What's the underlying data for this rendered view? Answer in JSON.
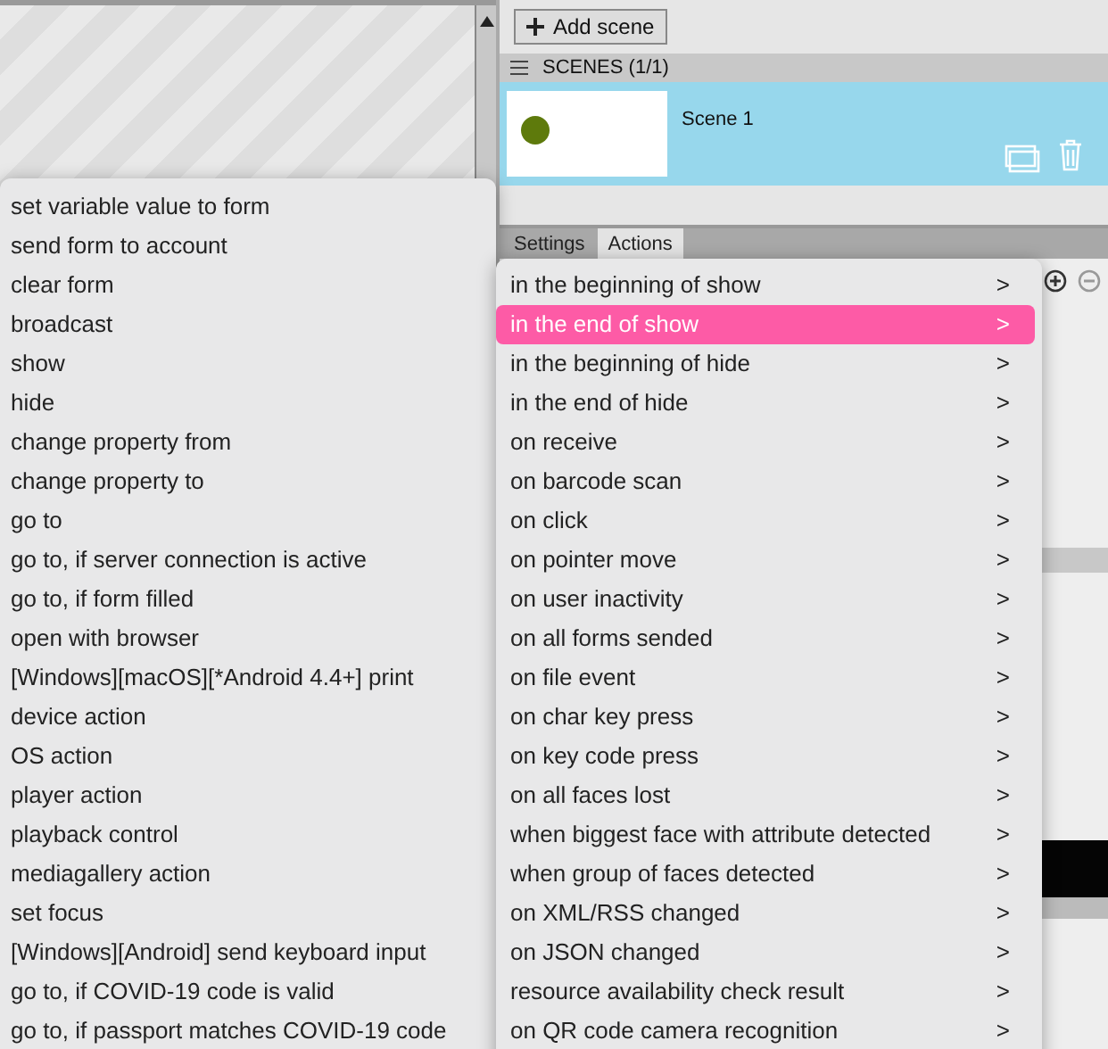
{
  "toolbar": {
    "add_button": "Add scene"
  },
  "scenes": {
    "header": "SCENES (1/1)",
    "items": [
      {
        "name": "Scene 1",
        "selected": true
      }
    ]
  },
  "tabs": [
    {
      "label": "Settings",
      "selected": false
    },
    {
      "label": "Actions",
      "selected": true
    }
  ],
  "action_menu": {
    "items": [
      {
        "label": "set variable value to form"
      },
      {
        "label": "send form to account"
      },
      {
        "label": "clear form"
      },
      {
        "label": "broadcast"
      },
      {
        "label": "show"
      },
      {
        "label": "hide"
      },
      {
        "label": "change property from"
      },
      {
        "label": "change property to"
      },
      {
        "label": "go to"
      },
      {
        "label": "go to, if server connection is active"
      },
      {
        "label": "go to, if form filled"
      },
      {
        "label": "open with browser"
      },
      {
        "label": "[Windows][macOS][*Android 4.4+] print"
      },
      {
        "label": "device action"
      },
      {
        "label": "OS action"
      },
      {
        "label": "player action"
      },
      {
        "label": "playback control"
      },
      {
        "label": "mediagallery action"
      },
      {
        "label": "set focus"
      },
      {
        "label": "[Windows][Android] send keyboard input"
      },
      {
        "label": "go to, if COVID-19 code is valid"
      },
      {
        "label": "go to, if passport matches COVID-19 code"
      }
    ]
  },
  "event_menu": {
    "items": [
      {
        "label": "in the beginning of show",
        "arrow": ">",
        "selected": false
      },
      {
        "label": "in the end of show",
        "arrow": ">",
        "selected": true
      },
      {
        "label": "in the beginning of hide",
        "arrow": ">",
        "selected": false
      },
      {
        "label": "in the end of hide",
        "arrow": ">",
        "selected": false
      },
      {
        "label": "on receive",
        "arrow": ">",
        "selected": false
      },
      {
        "label": "on barcode scan",
        "arrow": ">",
        "selected": false
      },
      {
        "label": "on click",
        "arrow": ">",
        "selected": false
      },
      {
        "label": "on pointer move",
        "arrow": ">",
        "selected": false
      },
      {
        "label": "on user inactivity",
        "arrow": ">",
        "selected": false
      },
      {
        "label": "on all forms sended",
        "arrow": ">",
        "selected": false
      },
      {
        "label": "on file event",
        "arrow": ">",
        "selected": false
      },
      {
        "label": "on char key press",
        "arrow": ">",
        "selected": false
      },
      {
        "label": "on key code press",
        "arrow": ">",
        "selected": false
      },
      {
        "label": "on all faces lost",
        "arrow": ">",
        "selected": false
      },
      {
        "label": "when biggest face with attribute detected",
        "arrow": ">",
        "selected": false
      },
      {
        "label": "when group of faces detected",
        "arrow": ">",
        "selected": false
      },
      {
        "label": "on XML/RSS changed",
        "arrow": ">",
        "selected": false
      },
      {
        "label": "on JSON changed",
        "arrow": ">",
        "selected": false
      },
      {
        "label": "resource availability check result",
        "arrow": ">",
        "selected": false
      },
      {
        "label": "on QR code camera recognition",
        "arrow": ">",
        "selected": false
      }
    ]
  }
}
